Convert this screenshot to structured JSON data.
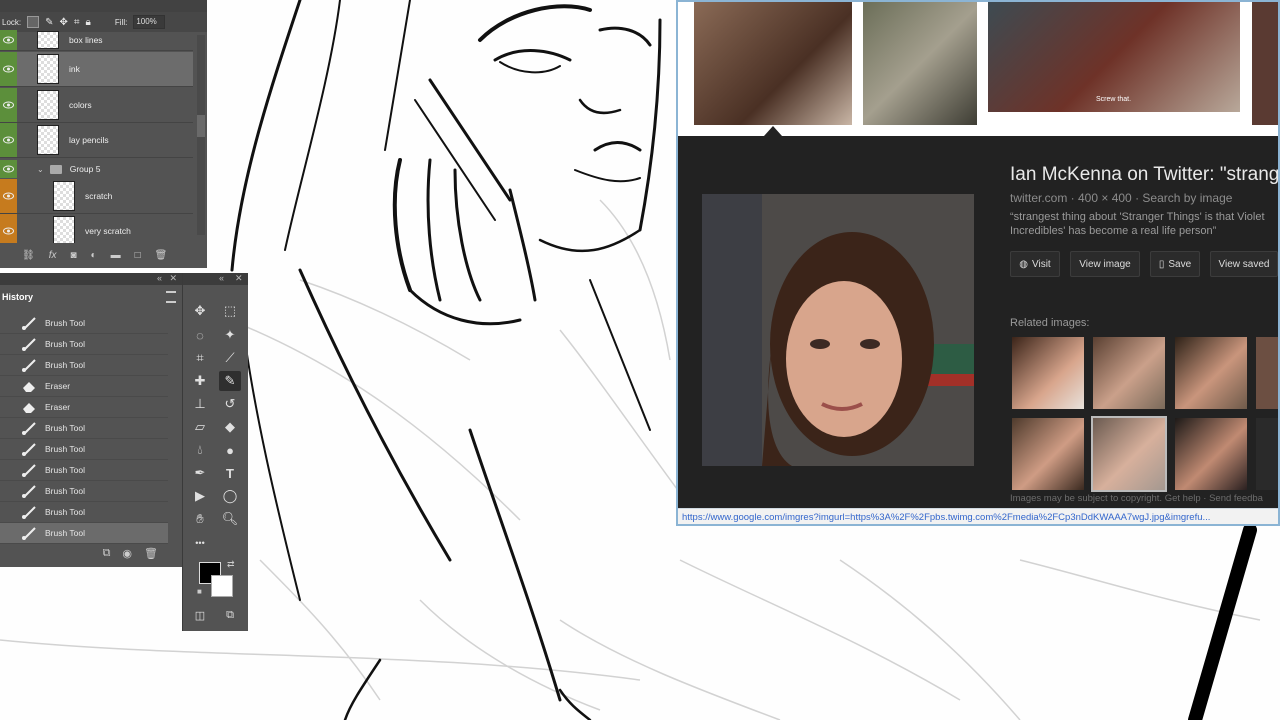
{
  "layers": {
    "fill_label": "Fill:",
    "fill_value": "100%",
    "lock_label": "Lock:",
    "rows": [
      {
        "name": "box lines"
      },
      {
        "name": "ink"
      },
      {
        "name": "colors"
      },
      {
        "name": "lay pencils"
      },
      {
        "name": "Group 5"
      },
      {
        "name": "scratch"
      },
      {
        "name": "very scratch"
      }
    ]
  },
  "history": {
    "tab": "History",
    "items": [
      {
        "label": "Brush Tool",
        "icon": "brush-icon"
      },
      {
        "label": "Brush Tool",
        "icon": "brush-icon"
      },
      {
        "label": "Brush Tool",
        "icon": "brush-icon"
      },
      {
        "label": "Eraser",
        "icon": "eraser-icon"
      },
      {
        "label": "Eraser",
        "icon": "eraser-icon"
      },
      {
        "label": "Brush Tool",
        "icon": "brush-icon"
      },
      {
        "label": "Brush Tool",
        "icon": "brush-icon"
      },
      {
        "label": "Brush Tool",
        "icon": "brush-icon"
      },
      {
        "label": "Brush Tool",
        "icon": "brush-icon"
      },
      {
        "label": "Brush Tool",
        "icon": "brush-icon"
      },
      {
        "label": "Brush Tool",
        "icon": "brush-icon"
      }
    ]
  },
  "tools": {
    "foreground_color": "#000000",
    "background_color": "#ffffff",
    "type_tool_glyph": "T",
    "more_glyph": "•••"
  },
  "google": {
    "title": "Ian McKenna on Twitter: \"strang",
    "meta": "twitter.com · 400 × 400 · Search by image",
    "desc": "“strangest thing about 'Stranger Things' is that Violet Incredibles' has become a real life person”",
    "buttons": {
      "visit": "Visit",
      "view_image": "View image",
      "save": "Save",
      "view_saved": "View saved"
    },
    "related_label": "Related images:",
    "footer": "Images may be subject to copyright.   Get help  ·  Send feedba",
    "strip_caption": "Screw that.",
    "url": "https://www.google.com/imgres?imgurl=https%3A%2F%2Fpbs.twimg.com%2Fmedia%2FCp3nDdKWAAA7wgJ.jpg&imgrefu..."
  }
}
